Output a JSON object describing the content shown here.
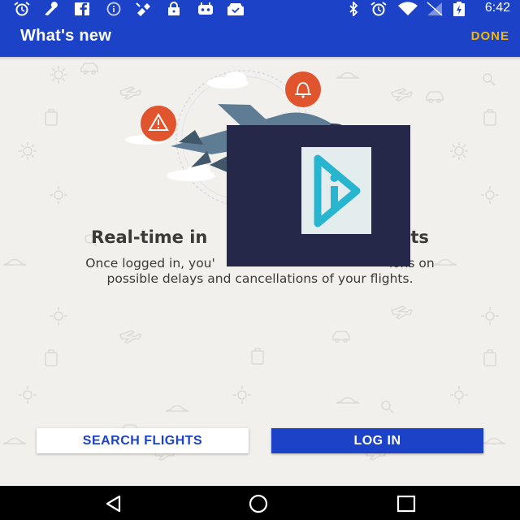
{
  "status_bar": {
    "time": "6:42",
    "left_icons": [
      "alarm-icon",
      "wrench-icon",
      "facebook-icon",
      "info-icon",
      "satellite-icon",
      "lock-icon",
      "bot-icon",
      "inbox-icon"
    ],
    "right_icons": [
      "bluetooth-icon",
      "alarm-icon",
      "wifi-icon",
      "no-signal-icon",
      "battery-icon"
    ]
  },
  "app_bar": {
    "title": "What's new",
    "done_label": "DONE"
  },
  "content": {
    "headline_left": "Real-time in",
    "headline_right": "ghts",
    "description_line1_left": "Once logged in, you'",
    "description_line1_right": "ions on",
    "description_line2": "possible delays and cancellations of your flights."
  },
  "buttons": {
    "search_flights": "SEARCH FLIGHTS",
    "log_in": "LOG IN"
  },
  "nav_bar": {
    "icons": [
      "back-icon",
      "home-icon",
      "recents-icon"
    ]
  },
  "colors": {
    "primary": "#1c43c7",
    "accent": "#f5b800",
    "alert_badge": "#e0552e",
    "background": "#f2f0ed",
    "overlay": "#262849",
    "logo_teal": "#27b5cf"
  }
}
